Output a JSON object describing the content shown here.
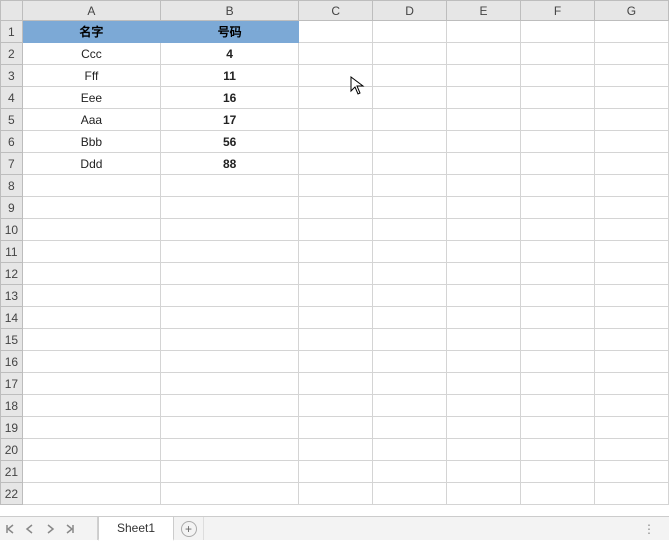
{
  "columns": [
    "A",
    "B",
    "C",
    "D",
    "E",
    "F",
    "G"
  ],
  "rowCount": 22,
  "dataColCount": 2,
  "header": {
    "A": "名字",
    "B": "号码"
  },
  "rows": [
    {
      "A": "Ccc",
      "B": "4"
    },
    {
      "A": "Fff",
      "B": "11"
    },
    {
      "A": "Eee",
      "B": "16"
    },
    {
      "A": "Aaa",
      "B": "17"
    },
    {
      "A": "Bbb",
      "B": "56"
    },
    {
      "A": "Ddd",
      "B": "88"
    }
  ],
  "sheet": {
    "name": "Sheet1",
    "add_label": "+"
  },
  "colors": {
    "header_bg": "#7ca9d6"
  }
}
